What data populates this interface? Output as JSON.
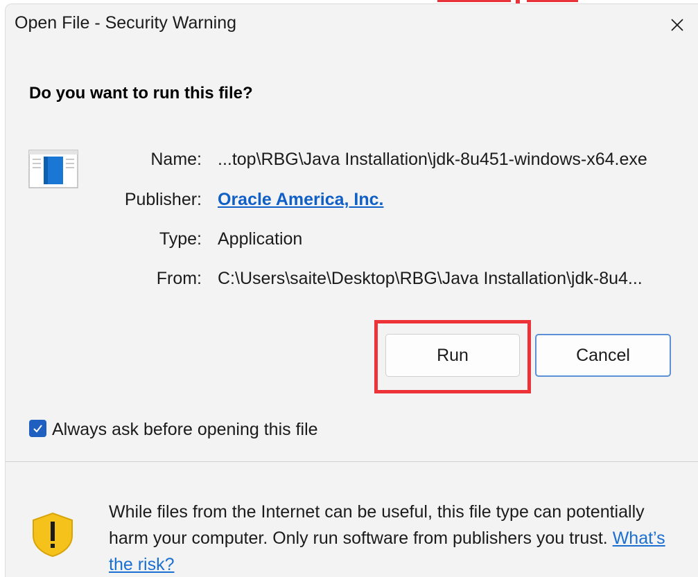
{
  "window": {
    "title": "Open File - Security Warning"
  },
  "prompt": {
    "question": "Do you want to run this file?"
  },
  "fields": [
    {
      "label": "Name:",
      "value": "...top\\RBG\\Java Installation\\jdk-8u451-windows-x64.exe"
    },
    {
      "label": "Publisher:",
      "value": "Oracle America, Inc."
    },
    {
      "label": "Type:",
      "value": "Application"
    },
    {
      "label": "From:",
      "value": "C:\\Users\\saite\\Desktop\\RBG\\Java Installation\\jdk-8u4..."
    }
  ],
  "buttons": {
    "run_label": "Run",
    "cancel_label": "Cancel"
  },
  "checkbox": {
    "label": "Always ask before opening this file",
    "checked": true
  },
  "warning": {
    "text": "While files from the Internet can be useful, this file type can potentially harm your computer. Only run software from publishers you trust.",
    "link_label": "What’s the risk?"
  },
  "icons": {
    "close": "close-icon",
    "file": "application-file-icon",
    "shield": "warning-shield-icon",
    "checkmark": "checkmark-icon"
  },
  "colors": {
    "accent": "#1f5fbf",
    "link": "#0f5fc7",
    "highlight": "#ee3338",
    "shield": "#f4c21b"
  }
}
